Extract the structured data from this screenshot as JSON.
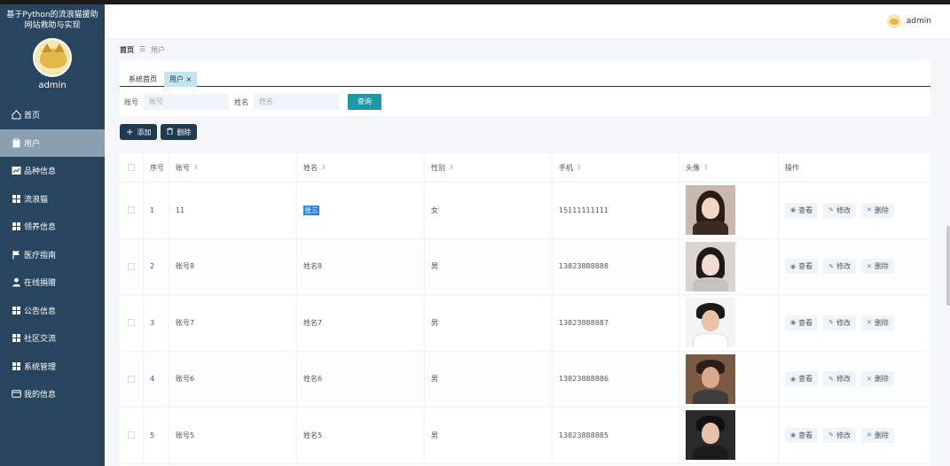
{
  "app": {
    "system_title": "基于Python的流浪猫援助网站救助与实现",
    "sidebar_user": "admin",
    "header_user": "admin"
  },
  "sidebar": {
    "items": [
      {
        "label": "首页",
        "icon": "home-icon"
      },
      {
        "label": "用户",
        "icon": "user-clipboard-icon",
        "active": true
      },
      {
        "label": "品种信息",
        "icon": "chart-icon"
      },
      {
        "label": "流浪猫",
        "icon": "grid-icon"
      },
      {
        "label": "领养信息",
        "icon": "grid-icon"
      },
      {
        "label": "医疗指南",
        "icon": "flag-icon"
      },
      {
        "label": "在线捐赠",
        "icon": "person-icon"
      },
      {
        "label": "公告信息",
        "icon": "grid-icon"
      },
      {
        "label": "社区交流",
        "icon": "grid-icon"
      },
      {
        "label": "系统管理",
        "icon": "grid-icon"
      },
      {
        "label": "我的信息",
        "icon": "card-icon"
      }
    ]
  },
  "breadcrumb": {
    "home": "首页",
    "separator": "☰",
    "current": "用户"
  },
  "tabs": {
    "home": "系统首页",
    "current": "用户",
    "close": "×"
  },
  "search": {
    "account_label": "账号",
    "account_placeholder": "账号",
    "name_label": "姓名",
    "name_placeholder": "姓名",
    "query_button": "查询"
  },
  "actions": {
    "add": "添加",
    "delete": "删除"
  },
  "table": {
    "headers": {
      "index": "序号",
      "account": "账号",
      "name": "姓名",
      "gender": "性别",
      "phone": "手机",
      "avatar": "头像",
      "ops": "操作"
    },
    "sort_glyph": "⇕",
    "ops": {
      "view": "查看",
      "edit": "修改",
      "delete": "删除"
    },
    "rows": [
      {
        "index": "1",
        "account": "11",
        "name": "张三",
        "gender": "女",
        "phone": "15111111111"
      },
      {
        "index": "2",
        "account": "账号8",
        "name": "姓名8",
        "gender": "男",
        "phone": "13823888888"
      },
      {
        "index": "3",
        "account": "账号7",
        "name": "姓名7",
        "gender": "男",
        "phone": "13823888887"
      },
      {
        "index": "4",
        "account": "账号6",
        "name": "姓名6",
        "gender": "男",
        "phone": "13823888886"
      },
      {
        "index": "5",
        "account": "账号5",
        "name": "姓名5",
        "gender": "男",
        "phone": "13823888885"
      }
    ]
  },
  "colors": {
    "sidebar_bg": "#27455e",
    "active_item": "#8aa0b0",
    "query_btn": "#1b9aa6",
    "action_btn": "#1f3a50"
  }
}
